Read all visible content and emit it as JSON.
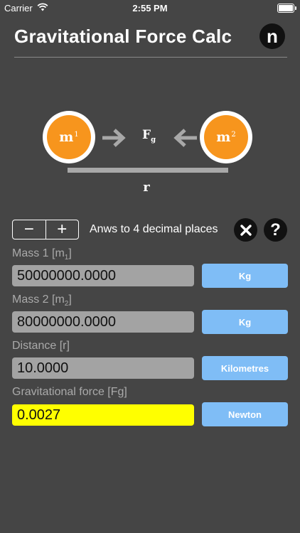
{
  "status_bar": {
    "carrier": "Carrier",
    "time": "2:55 PM"
  },
  "header": {
    "title": "Gravitational Force Calc",
    "info_button": "n"
  },
  "diagram": {
    "mass1": {
      "symbol": "m",
      "index": "1"
    },
    "mass2": {
      "symbol": "m",
      "index": "2"
    },
    "force": {
      "symbol": "F",
      "index": "g"
    },
    "arrow_glyph": "→",
    "arrow_back_glyph": "←",
    "distance_label": "r"
  },
  "controls": {
    "minus": "−",
    "plus": "+",
    "decimals_label": "Anws to 4 decimal places",
    "clear_glyph": "✕",
    "help_glyph": "?"
  },
  "fields": [
    {
      "label": "Mass 1 [m",
      "sub": "1",
      "close": "]",
      "value": "50000000.0000",
      "unit": "Kg"
    },
    {
      "label": "Mass 2 [m",
      "sub": "2",
      "close": "]",
      "value": "80000000.0000",
      "unit": "Kg"
    },
    {
      "label": "Distance [r]",
      "sub": "",
      "close": "",
      "value": "10.0000",
      "unit": "Kilometres"
    },
    {
      "label": "Gravitational force [Fg]",
      "sub": "",
      "close": "",
      "value": "0.0027",
      "unit": "Newton"
    }
  ],
  "colors": {
    "background": "#454545",
    "mass": "#f7951d",
    "unit_button": "#7fbdf6",
    "result_field": "#ffff00",
    "input_field": "#a3a3a3"
  }
}
